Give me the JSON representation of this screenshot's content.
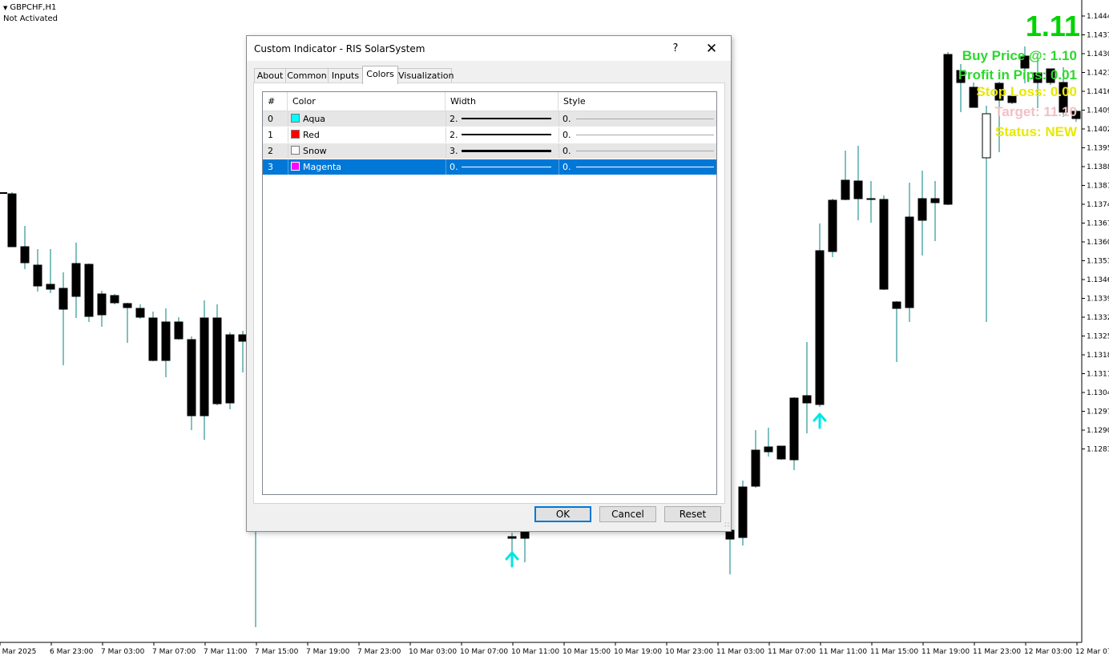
{
  "chart": {
    "symbol": "GBPCHF,H1",
    "status": "Not Activated",
    "overlay": {
      "big_value": "1.11",
      "buy_price": "Buy Price @: 1.10",
      "profit": "Profit in Pips: 0.01",
      "stop_loss": "Stop Loss: 0.00",
      "target": "Target: 11.10",
      "status": "Status: NEW"
    },
    "price_axis": [
      "1.1444",
      "1.1437",
      "1.1430",
      "1.1423",
      "1.1416",
      "1.1409",
      "1.1402",
      "1.1395",
      "1.1388",
      "1.1381",
      "1.1374",
      "1.1367",
      "1.1360",
      "1.1353",
      "1.1346",
      "1.1339",
      "1.1332",
      "1.1325",
      "1.1318",
      "1.1311",
      "1.1304",
      "1.1297",
      "1.1290",
      "1.1283"
    ],
    "time_axis": [
      "6 Mar 2025",
      "6 Mar 23:00",
      "7 Mar 03:00",
      "7 Mar 07:00",
      "7 Mar 11:00",
      "7 Mar 15:00",
      "7 Mar 19:00",
      "7 Mar 23:00",
      "10 Mar 03:00",
      "10 Mar 07:00",
      "10 Mar 11:00",
      "10 Mar 15:00",
      "10 Mar 19:00",
      "10 Mar 23:00",
      "11 Mar 03:00",
      "11 Mar 07:00",
      "11 Mar 11:00",
      "11 Mar 15:00",
      "11 Mar 19:00",
      "11 Mar 23:00",
      "12 Mar 03:00",
      "12 Mar 07"
    ],
    "colors": {
      "bull_body": "#ffffff",
      "bear_body": "#000000",
      "wick": "#008080",
      "arrow": "#00e5e5"
    }
  },
  "dialog": {
    "title": "Custom Indicator - RIS SolarSystem",
    "help_label": "?",
    "close_label": "✕",
    "tabs": [
      {
        "label": "About"
      },
      {
        "label": "Common"
      },
      {
        "label": "Inputs"
      },
      {
        "label": "Colors"
      },
      {
        "label": "Visualization"
      }
    ],
    "active_tab": "Colors",
    "columns": [
      "#",
      "Color",
      "Width",
      "Style"
    ],
    "rows": [
      {
        "index": "0",
        "color_name": "Aqua",
        "swatch": "#00ffff",
        "width": "2.",
        "style": "0."
      },
      {
        "index": "1",
        "color_name": "Red",
        "swatch": "#ff0000",
        "width": "2.",
        "style": "0."
      },
      {
        "index": "2",
        "color_name": "Snow",
        "swatch": "#fffafa",
        "width": "3.",
        "style": "0."
      },
      {
        "index": "3",
        "color_name": "Magenta",
        "swatch": "#ff00ff",
        "width": "0.",
        "style": "0."
      }
    ],
    "selected_row": 3,
    "buttons": {
      "ok": "OK",
      "cancel": "Cancel",
      "reset": "Reset"
    }
  }
}
